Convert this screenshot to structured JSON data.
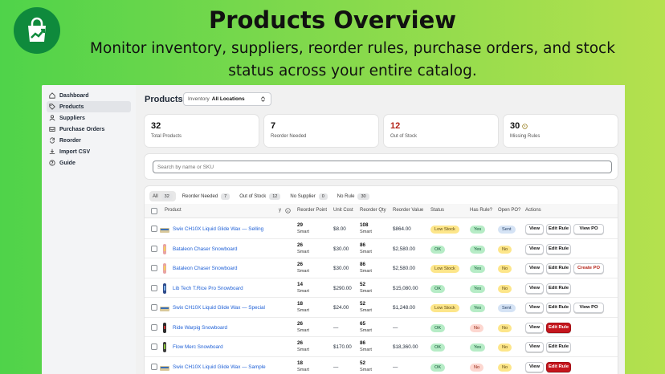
{
  "hero": {
    "title": "Products Overview",
    "subtitle": "Monitor inventory, suppliers, reorder rules, purchase orders, and stock status across your entire catalog."
  },
  "sidebar": {
    "items": [
      {
        "label": "Dashboard",
        "icon": "home-icon"
      },
      {
        "label": "Products",
        "icon": "tag-icon",
        "active": true
      },
      {
        "label": "Suppliers",
        "icon": "person-icon"
      },
      {
        "label": "Purchase Orders",
        "icon": "inbox-icon"
      },
      {
        "label": "Reorder",
        "icon": "refresh-icon"
      },
      {
        "label": "Import CSV",
        "icon": "import-icon"
      },
      {
        "label": "Guide",
        "icon": "help-icon"
      }
    ]
  },
  "header": {
    "title": "Products",
    "location_label": "Inventory",
    "location_value": "All Locations"
  },
  "stats": [
    {
      "value": "32",
      "label": "Total Products"
    },
    {
      "value": "7",
      "label": "Reorder Needed"
    },
    {
      "value": "12",
      "label": "Out of Stock"
    },
    {
      "value": "30",
      "label": "Missing Rules"
    }
  ],
  "search": {
    "placeholder": "Search by name or SKU"
  },
  "tabs": [
    {
      "label": "All",
      "count": "32"
    },
    {
      "label": "Reorder Needed",
      "count": "7"
    },
    {
      "label": "Out of Stock",
      "count": "12"
    },
    {
      "label": "No Supplier",
      "count": "0"
    },
    {
      "label": "No Rule",
      "count": "30"
    }
  ],
  "columns": {
    "product": "Product",
    "y": "y",
    "reorder_point": "Reorder Point",
    "unit_cost": "Unit Cost",
    "reorder_qty": "Reorder Qty",
    "reorder_value": "Reorder Value",
    "status": "Status",
    "has_rule": "Has Rule?",
    "open_po": "Open PO?",
    "actions": "Actions"
  },
  "rows": [
    {
      "name": "Swix CH10X Liquid Glide Wax — Selling",
      "thumb": "wax",
      "rp": "29",
      "rp_sub": "Smart",
      "cost": "$8.00",
      "qty": "108",
      "qty_sub": "Smart",
      "value": "$864.00",
      "status": "Low Stock",
      "has_rule": "Yes",
      "open_po": "Sent",
      "a1": "View",
      "a2": "Edit Rule",
      "a3": "View PO"
    },
    {
      "name": "Bataleon Chaser Snowboard",
      "thumb": "board-pink",
      "rp": "26",
      "rp_sub": "Smart",
      "cost": "$30.00",
      "qty": "86",
      "qty_sub": "Smart",
      "value": "$2,580.00",
      "status": "OK",
      "has_rule": "Yes",
      "open_po": "No",
      "a1": "View",
      "a2": "Edit Rule",
      "a3": ""
    },
    {
      "name": "Bataleon Chaser Snowboard",
      "thumb": "board-pink",
      "rp": "26",
      "rp_sub": "Smart",
      "cost": "$30.00",
      "qty": "86",
      "qty_sub": "Smart",
      "value": "$2,580.00",
      "status": "Low Stock",
      "has_rule": "Yes",
      "open_po": "No",
      "a1": "View",
      "a2": "Edit Rule",
      "a3": "Create PO"
    },
    {
      "name": "Lib Tech T.Rice Pro Snowboard",
      "thumb": "board-blue",
      "rp": "14",
      "rp_sub": "Smart",
      "cost": "$290.00",
      "qty": "52",
      "qty_sub": "Smart",
      "value": "$15,080.00",
      "status": "OK",
      "has_rule": "Yes",
      "open_po": "No",
      "a1": "View",
      "a2": "Edit Rule",
      "a3": ""
    },
    {
      "name": "Swix CH10X Liquid Glide Wax — Special",
      "thumb": "wax",
      "rp": "18",
      "rp_sub": "Smart",
      "cost": "$24.00",
      "qty": "52",
      "qty_sub": "Smart",
      "value": "$1,248.00",
      "status": "Low Stock",
      "has_rule": "Yes",
      "open_po": "Sent",
      "a1": "View",
      "a2": "Edit Rule",
      "a3": "View PO"
    },
    {
      "name": "Ride Warpig Snowboard",
      "thumb": "board-dark",
      "rp": "26",
      "rp_sub": "Smart",
      "cost": "—",
      "qty": "65",
      "qty_sub": "Smart",
      "value": "—",
      "status": "OK",
      "has_rule": "No",
      "open_po": "No",
      "a1": "View",
      "a2": "Edit Rule",
      "a3": ""
    },
    {
      "name": "Flow Merc Snowboard",
      "thumb": "board-green",
      "rp": "26",
      "rp_sub": "Smart",
      "cost": "$170.00",
      "qty": "86",
      "qty_sub": "Smart",
      "value": "$18,360.00",
      "status": "OK",
      "has_rule": "Yes",
      "open_po": "No",
      "a1": "View",
      "a2": "Edit Rule",
      "a3": ""
    },
    {
      "name": "Swix CH10X Liquid Glide Wax — Sample",
      "thumb": "wax",
      "rp": "18",
      "rp_sub": "Smart",
      "cost": "—",
      "qty": "52",
      "qty_sub": "Smart",
      "value": "—",
      "status": "OK",
      "has_rule": "No",
      "open_po": "No",
      "a1": "View",
      "a2": "Edit Rule",
      "a3": ""
    }
  ],
  "colors": {
    "accent_red": "#c5161d",
    "link_blue": "#1d5fd6",
    "brand_green": "#0f8a3c"
  }
}
